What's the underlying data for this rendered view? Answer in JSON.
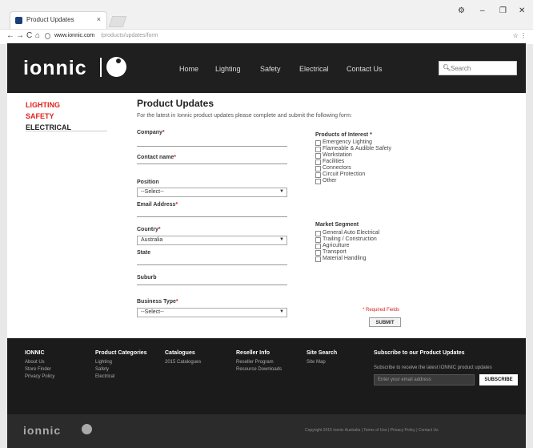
{
  "browser": {
    "tab_title": "Product Updates",
    "tab_close": "×",
    "window_controls": [
      "⚙",
      "–",
      "❐",
      "✕"
    ],
    "nav_buttons": [
      "←",
      "→",
      "C",
      "⌂"
    ],
    "url_domain": "www.ionnic.com",
    "url_rest": "/products/updates/form",
    "addr_right": "☆ ⋮"
  },
  "header": {
    "logo": "ionnic",
    "nav": [
      "Home",
      "Lighting",
      "Safety",
      "Electrical",
      "Contact Us"
    ],
    "search_placeholder": "Search"
  },
  "sidebar": {
    "items": [
      {
        "label": "LIGHTING",
        "color": "#e0221c"
      },
      {
        "label": "SAFETY",
        "color": "#e0221c"
      },
      {
        "label": "ELECTRICAL",
        "color": "#222222"
      }
    ]
  },
  "main": {
    "title": "Product Updates",
    "intro": "For the latest in Ionnic product updates please complete and submit the following form:",
    "fields": [
      {
        "label": "Company",
        "required": "*"
      },
      {
        "label": "Contact name",
        "required": "*"
      },
      {
        "label": "Position",
        "required": "",
        "select": "--Select--"
      },
      {
        "label": "Email Address",
        "required": "*"
      },
      {
        "label": "Country",
        "required": "*",
        "select": "Australia"
      },
      {
        "label": "State",
        "required": ""
      },
      {
        "label": "Suburb",
        "required": ""
      },
      {
        "label": "Business Type",
        "required": "*",
        "select": "--Select--"
      }
    ],
    "products_title": "Products of Interest *",
    "products": [
      "Emergency Lighting",
      "Flameable & Audible Safety",
      "Workstation",
      "Facilities",
      "Connectors",
      "Circuit Protection",
      "Other"
    ],
    "market_title": "Market Segment",
    "markets": [
      "General Auto Electrical",
      "Trailing / Construction",
      "Agriculture",
      "Transport",
      "Material Handling"
    ],
    "required_note": "* Required Fields",
    "submit_label": "SUBMIT"
  },
  "footer": {
    "columns": [
      {
        "head": "IONNIC",
        "links": [
          "About Us",
          "Store Finder",
          "Privacy Policy"
        ]
      },
      {
        "head": "Product Categories",
        "links": [
          "Lighting",
          "Safety",
          "Electrical"
        ]
      },
      {
        "head": "Catalogues",
        "links": [
          "2015 Catalogues"
        ]
      },
      {
        "head": "Reseller Info",
        "links": [
          "Reseller Program",
          "Resource Downloads"
        ]
      },
      {
        "head": "Site Search",
        "links": [
          "Site Map"
        ]
      }
    ],
    "subscribe_title": "Subscribe to our Product Updates",
    "subscribe_text": "Subscribe to receive the latest IONNIC product updates",
    "email_placeholder": "Enter your email address",
    "subscribe_label": "SUBSCRIBE",
    "bottom_logo": "ionnic",
    "bottom_text": "Copyright 2015 Ionnic Australia  |  Terms of Use  |  Privacy Policy  |  Contact Us"
  }
}
